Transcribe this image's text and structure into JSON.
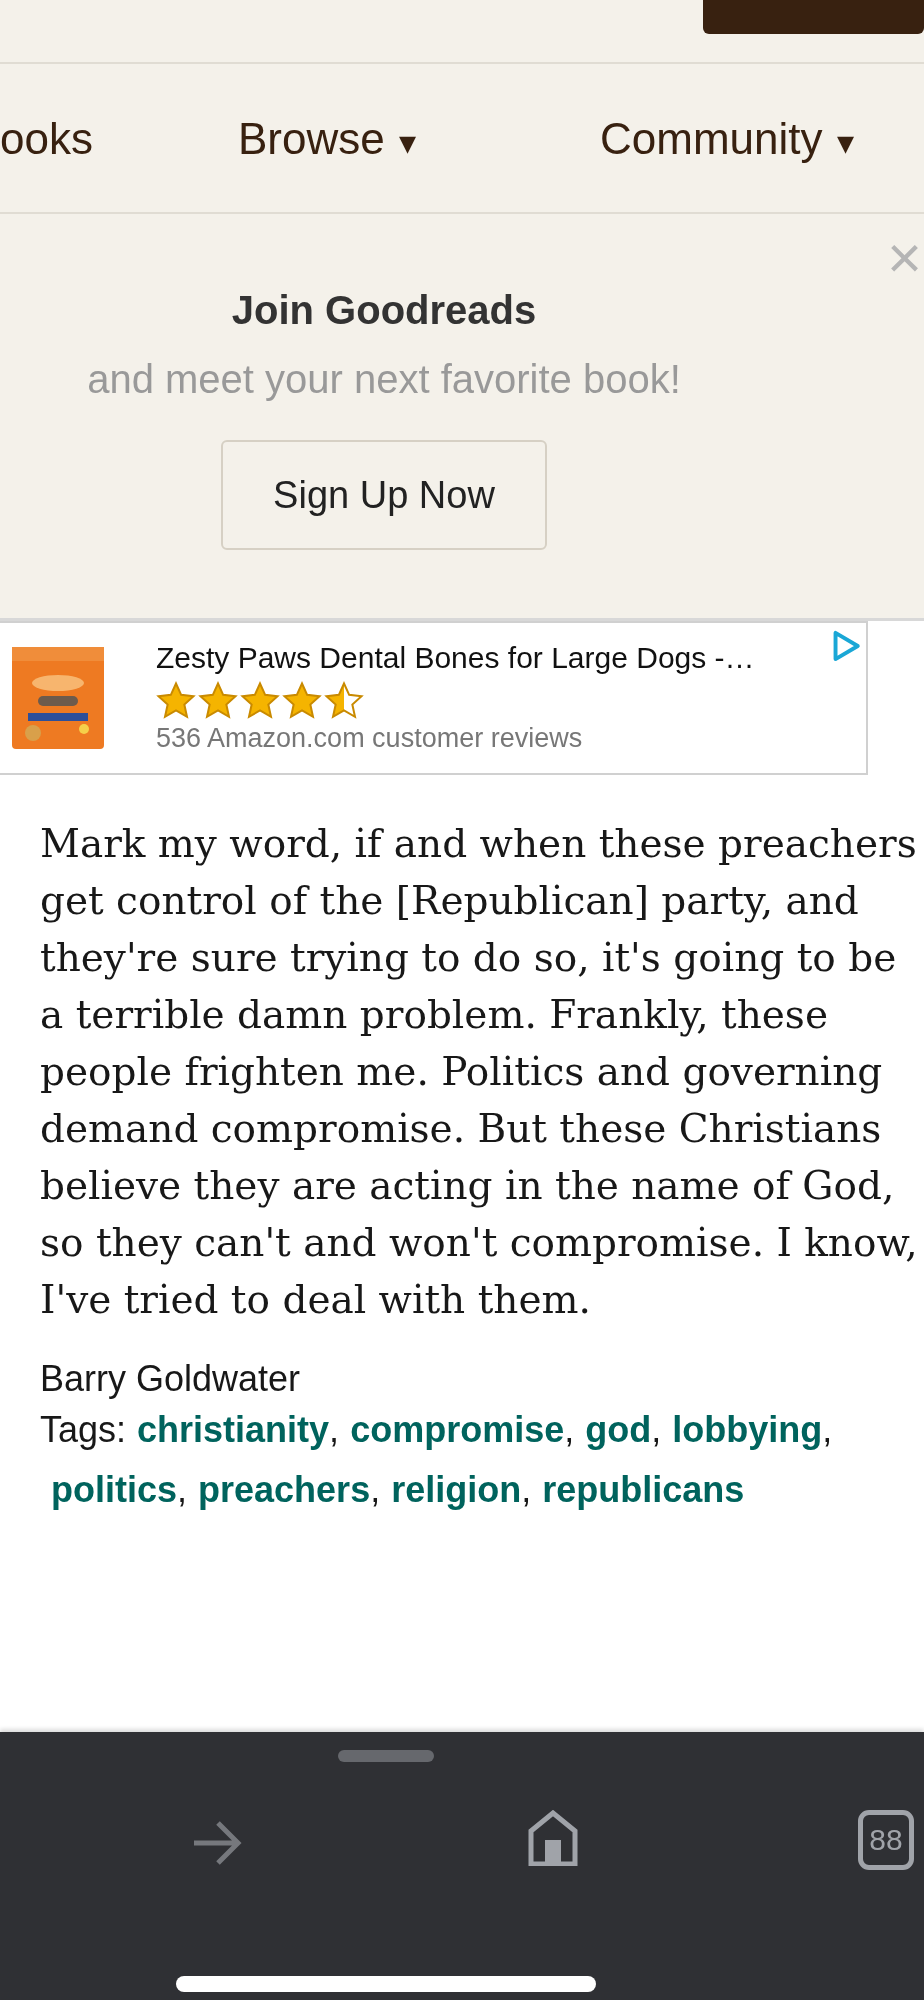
{
  "nav": {
    "items": [
      {
        "label": "ooks",
        "has_menu": false
      },
      {
        "label": "Browse",
        "has_menu": true
      },
      {
        "label": "Community",
        "has_menu": true
      }
    ],
    "menu_caret": "▾"
  },
  "join_banner": {
    "title": "Join Goodreads",
    "subtitle": "and meet your next favorite book!",
    "button": "Sign Up Now",
    "close": "×"
  },
  "ad": {
    "title": "Zesty Paws Dental Bones for Large Dogs -…",
    "stars": 4.5,
    "reviews": "536 Amazon.com customer reviews"
  },
  "quote": {
    "text": "Mark my word, if and when these preachers get control of the [Republican] party, and they're sure trying to do so, it's going to be a terrible damn problem. Frankly, these people frighten me. Politics and governing demand compromise. But these Christians believe they are acting in the name of God, so they can't and won't compromise. I know, I've tried to deal with them.",
    "author": "Barry Goldwater",
    "tags_label": "Tags:",
    "tag_separator": ",",
    "tags": [
      "christianity",
      "compromise",
      "god",
      "lobbying",
      "politics",
      "preachers",
      "religion",
      "republicans"
    ]
  },
  "browser_toolbar": {
    "tab_count": "88"
  }
}
